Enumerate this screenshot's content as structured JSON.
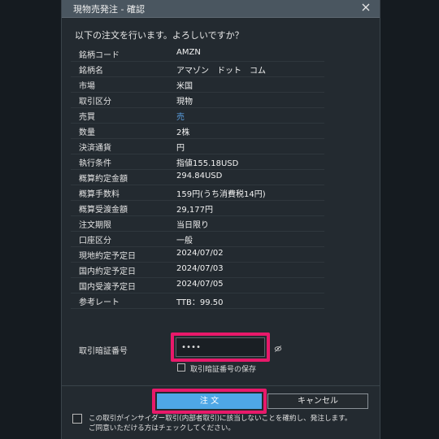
{
  "dialog": {
    "title": "現物売発注 - 確認",
    "prompt": "以下の注文を行います。よろしいですか？"
  },
  "rows": [
    {
      "label": "銘柄コード",
      "value": "AMZN"
    },
    {
      "label": "銘柄名",
      "value": "アマゾン　ドット　コム"
    },
    {
      "label": "市場",
      "value": "米国"
    },
    {
      "label": "取引区分",
      "value": "現物"
    },
    {
      "label": "売買",
      "value": "売"
    },
    {
      "label": "数量",
      "value": "2株"
    },
    {
      "label": "決済通貨",
      "value": "円"
    },
    {
      "label": "執行条件",
      "value": "指値155.18USD"
    },
    {
      "label": "概算約定金額",
      "value": "294.84USD"
    },
    {
      "label": "概算手数料",
      "value": "159円(うち消費税14円)"
    },
    {
      "label": "概算受渡金額",
      "value": "29,177円"
    },
    {
      "label": "注文期限",
      "value": "当日限り"
    },
    {
      "label": "口座区分",
      "value": "一般"
    },
    {
      "label": "現地約定予定日",
      "value": "2024/07/02"
    },
    {
      "label": "国内約定予定日",
      "value": "2024/07/03"
    },
    {
      "label": "国内受渡予定日",
      "value": "2024/07/05"
    },
    {
      "label": "参考レート",
      "value": "TTB：99.50"
    }
  ],
  "pin": {
    "label": "取引暗証番号",
    "value": "••••",
    "save_label": "取引暗証番号の保存"
  },
  "buttons": {
    "order": "注 文",
    "cancel": "キャンセル"
  },
  "confirm": {
    "line1": "この取引がインサイダー取引(内部者取引)に該当しないことを確約し、発注します。",
    "line2": "ご同意いただける方はチェックしてください。"
  },
  "colors": {
    "accent_blue": "#4ea7e6",
    "sell_blue": "#5a9ee0",
    "highlight_pink": "#e8196a"
  },
  "icons": {
    "close": "close-icon",
    "eye": "eye-slash-icon"
  }
}
